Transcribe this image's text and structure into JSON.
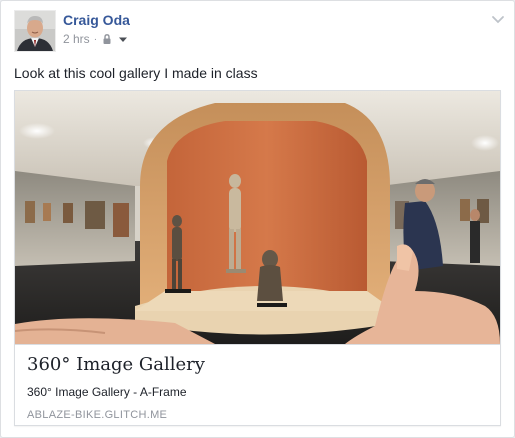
{
  "post": {
    "author": "Craig Oda",
    "timestamp": "2 hrs",
    "separator": "·",
    "audience_icon": "lock-icon",
    "menu_icon": "chevron-down-icon",
    "message": "Look at this cool gallery I made in class"
  },
  "link_preview": {
    "title": "360° Image Gallery",
    "description": "360° Image Gallery - A-Frame",
    "domain": "ABLAZE-BIKE.GLITCH.ME"
  },
  "colors": {
    "author_link": "#365899",
    "meta_gray": "#90949c",
    "body_text": "#1d2129",
    "page_bg": "#e9ebee"
  }
}
